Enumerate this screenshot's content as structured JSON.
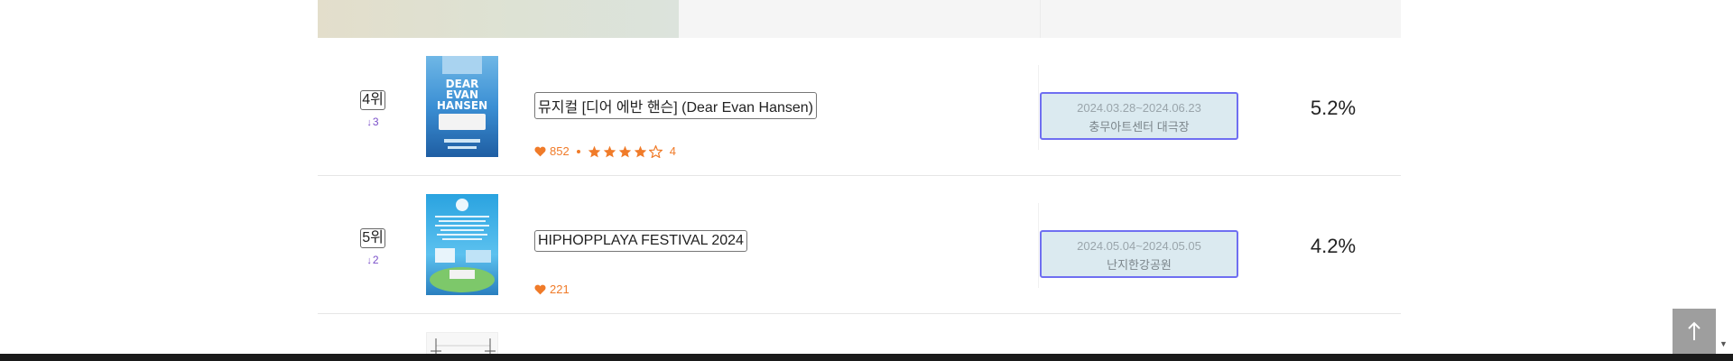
{
  "rankings": [
    {
      "rank": "4위",
      "change": "3",
      "change_direction": "down",
      "title": "뮤지컬 [디어 에반 핸슨] (Dear Evan Hansen)",
      "likes": "852",
      "rating": "4",
      "rating_stars": 4,
      "period": "2024.03.28~2024.06.23",
      "venue": "충무아트센터 대극장",
      "share": "5.2%",
      "poster_text": [
        "DEAR",
        "EVAN",
        "HANSEN"
      ]
    },
    {
      "rank": "5위",
      "change": "2",
      "change_direction": "down",
      "title": "HIPHOPPLAYA FESTIVAL 2024",
      "likes": "221",
      "period": "2024.05.04~2024.05.05",
      "venue": "난지한강공원",
      "share": "4.2%"
    }
  ],
  "colors": {
    "accent_orange": "#f07b29",
    "rank_change_purple": "#7a4fc9",
    "venue_box_bg": "#dbeaf0",
    "venue_box_border": "#6f6ff1"
  },
  "icons": {
    "like": "heart-icon",
    "star": "star-icon",
    "rank_change": "arrow-down-icon",
    "top_button": "arrow-up-icon"
  }
}
